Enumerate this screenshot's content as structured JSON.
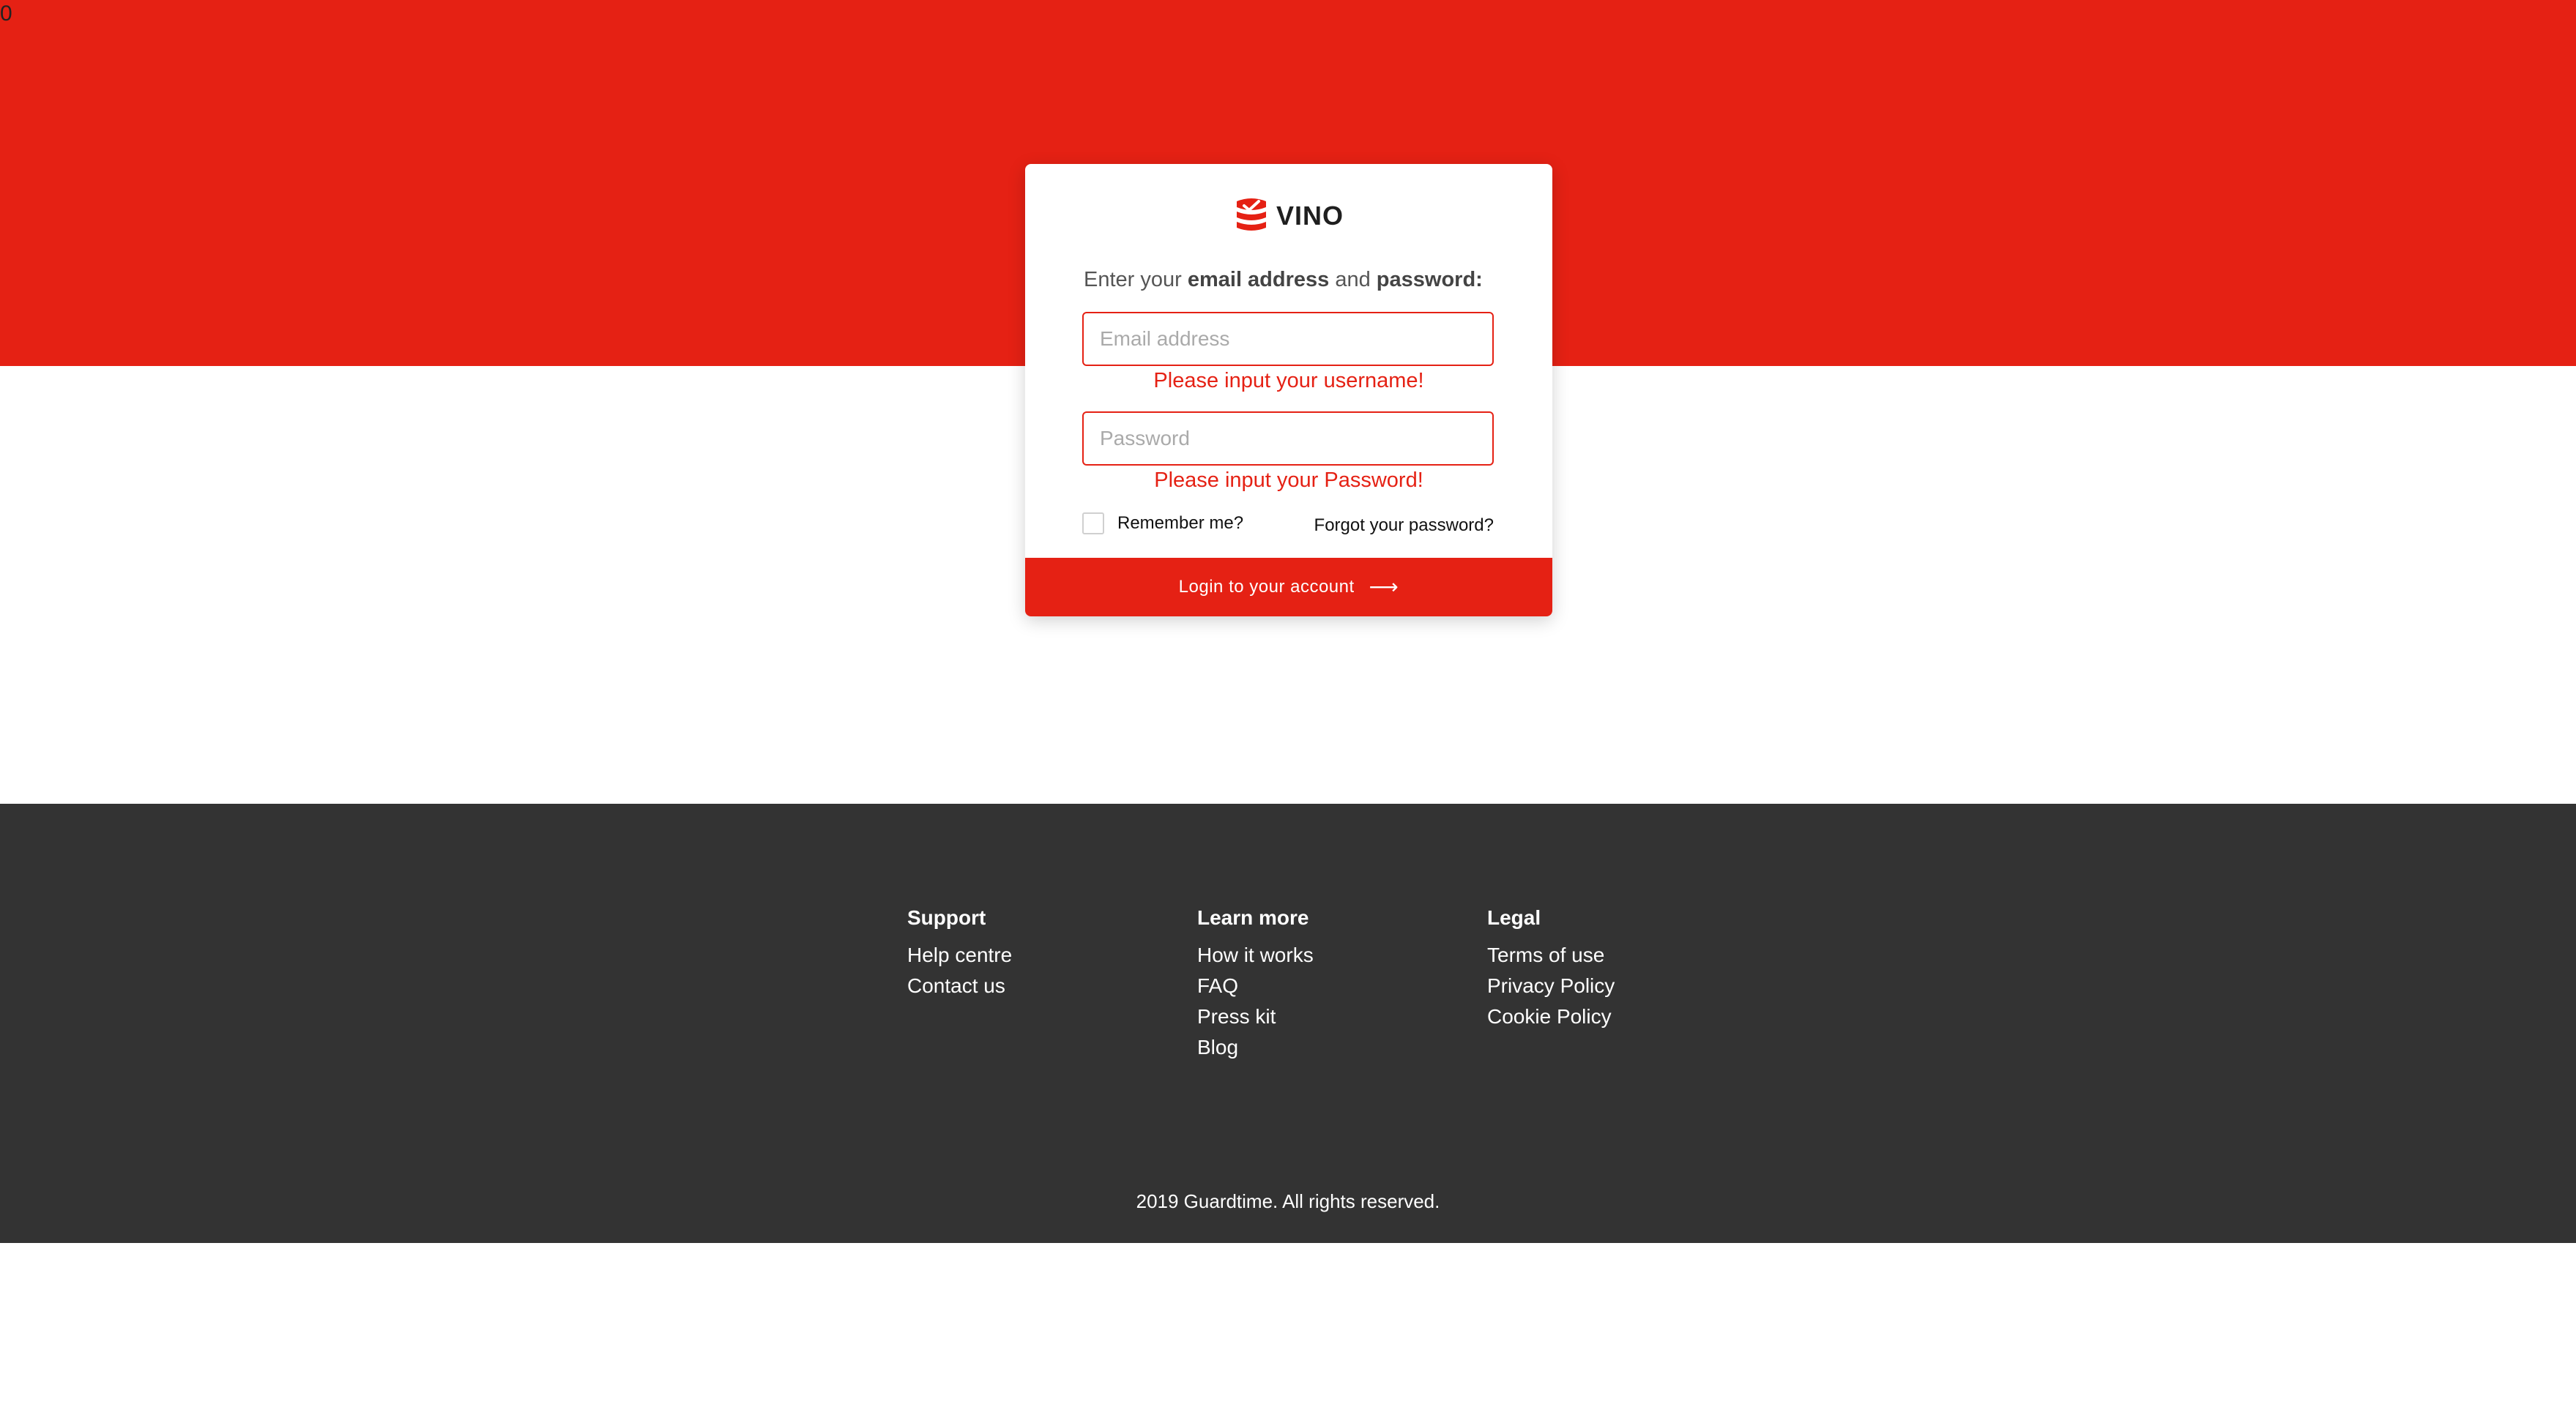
{
  "corner_text": "0",
  "colors": {
    "brand": "#e52114",
    "footer_bg": "#333333",
    "error": "#e52114"
  },
  "logo": {
    "icon": "vino-stack-icon",
    "text": "VINO"
  },
  "login": {
    "prompt_prefix": "Enter your ",
    "prompt_email": "email address",
    "prompt_and": " and ",
    "prompt_password": "password:",
    "email_placeholder": "Email address",
    "email_value": "",
    "email_error": "Please input your username!",
    "password_placeholder": "Password",
    "password_value": "",
    "password_error": "Please input your Password!",
    "remember_label": "Remember me?",
    "remember_checked": false,
    "forgot_label": "Forgot your password?",
    "submit_label": "Login to your account",
    "submit_icon": "arrow-right-icon"
  },
  "footer": {
    "columns": [
      {
        "title": "Support",
        "links": [
          "Help centre",
          "Contact us"
        ]
      },
      {
        "title": "Learn more",
        "links": [
          "How it works",
          "FAQ",
          "Press kit",
          "Blog"
        ]
      },
      {
        "title": "Legal",
        "links": [
          "Terms of use",
          "Privacy Policy",
          "Cookie Policy"
        ]
      }
    ],
    "copyright": "2019 Guardtime. All rights reserved."
  }
}
